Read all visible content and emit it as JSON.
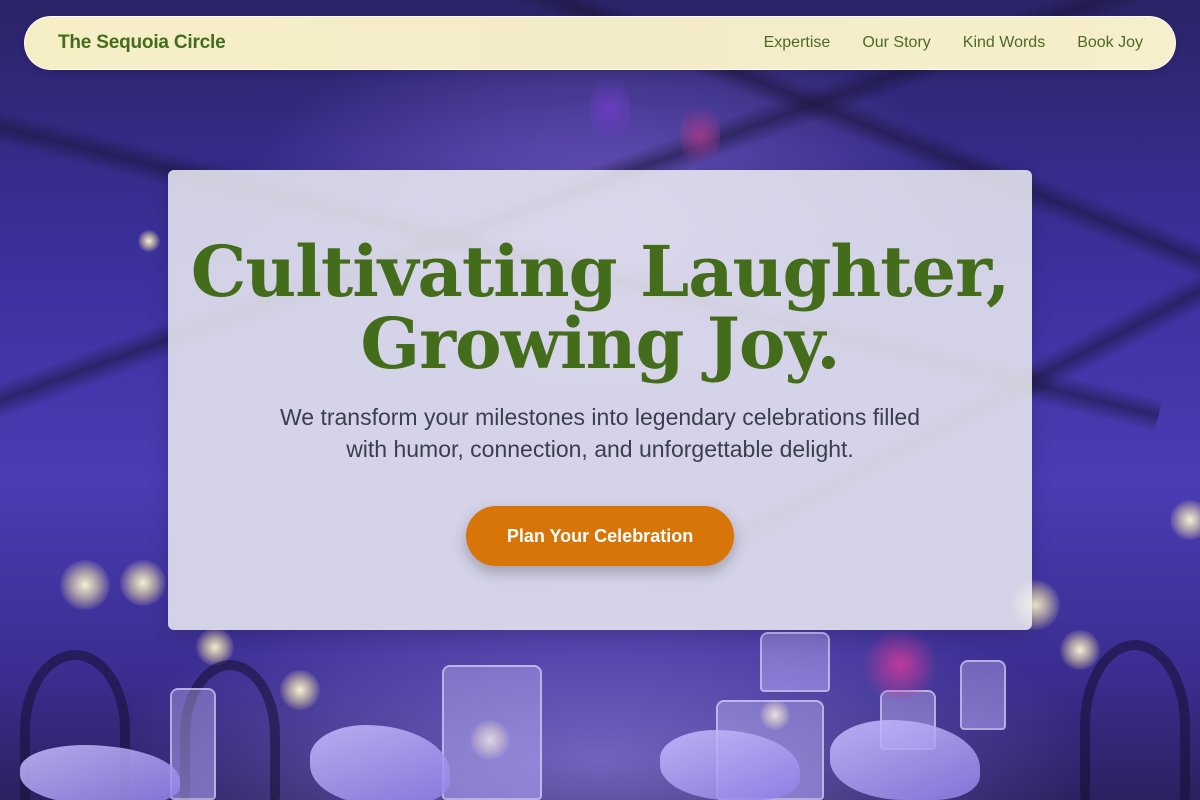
{
  "navbar": {
    "brand": "The Sequoia Circle",
    "links": [
      "Expertise",
      "Our Story",
      "Kind Words",
      "Book Joy"
    ]
  },
  "hero": {
    "title_line1": "Cultivating Laughter,",
    "title_line2": "Growing Joy.",
    "subtitle_line1": "We transform your milestones into legendary celebrations filled",
    "subtitle_line2": "with humor, connection, and unforgettable delight.",
    "cta_label": "Plan Your Celebration"
  },
  "colors": {
    "brand_green": "#436d1b",
    "cta_orange": "#d87508",
    "nav_bg": "#f4edc8",
    "background_purple": "#3d31a0"
  }
}
